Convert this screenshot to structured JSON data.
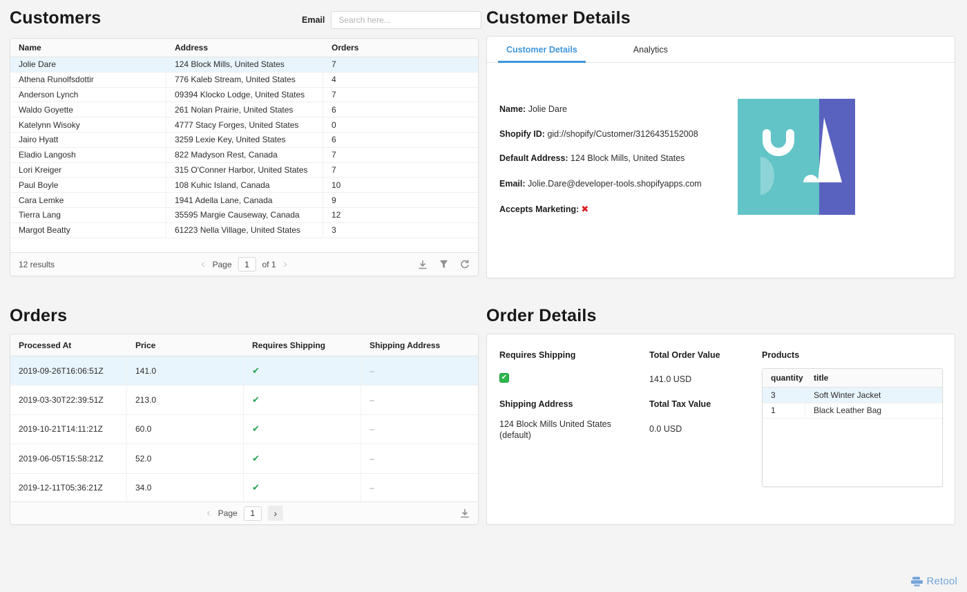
{
  "icons": {
    "chevron_left": "‹",
    "chevron_right": "›",
    "check_glyph": "✔",
    "cross_glyph": "✖",
    "footer_icons": [
      "download-icon",
      "filter-icon",
      "refresh-icon"
    ]
  },
  "colors": {
    "accent_blue": "#3f96db",
    "selected_row": "#e9f5fd",
    "check_green": "#21a453",
    "checkbox_green": "#2db84c",
    "cross_red": "#e01e1e",
    "avatar_teal": "#62c4c7",
    "avatar_indigo": "#5a62c0",
    "brand_blue": "#74a5da"
  },
  "customers": {
    "title": "Customers",
    "search": {
      "label": "Email",
      "placeholder": "Search here...",
      "value": ""
    },
    "table": {
      "columns": [
        "Name",
        "Address",
        "Orders"
      ],
      "selected_row": 0,
      "rows": [
        {
          "name": "Jolie Dare",
          "address": "124 Block Mills, United States",
          "orders": "7"
        },
        {
          "name": "Athena Runolfsdottir",
          "address": "776 Kaleb Stream, United States",
          "orders": "4"
        },
        {
          "name": "Anderson Lynch",
          "address": "09394 Klocko Lodge, United States",
          "orders": "7"
        },
        {
          "name": "Waldo Goyette",
          "address": "261 Nolan Prairie, United States",
          "orders": "6"
        },
        {
          "name": "Katelynn Wisoky",
          "address": "4777 Stacy Forges, United States",
          "orders": "0"
        },
        {
          "name": "Jairo Hyatt",
          "address": "3259 Lexie Key, United States",
          "orders": "6"
        },
        {
          "name": "Eladio Langosh",
          "address": "822 Madyson Rest, Canada",
          "orders": "7"
        },
        {
          "name": "Lori Kreiger",
          "address": "315 O'Conner Harbor, United States",
          "orders": "7"
        },
        {
          "name": "Paul Boyle",
          "address": "108 Kuhic Island, Canada",
          "orders": "10"
        },
        {
          "name": "Cara Lemke",
          "address": "1941 Adella Lane, Canada",
          "orders": "9"
        },
        {
          "name": "Tierra Lang",
          "address": "35595 Margie Causeway, Canada",
          "orders": "12"
        },
        {
          "name": "Margot Beatty",
          "address": "61223 Nella Village, United States",
          "orders": "3"
        }
      ],
      "footer": {
        "results": "12 results",
        "page_label": "Page",
        "page_value": "1",
        "of_label": "of 1"
      }
    }
  },
  "customer_details": {
    "title": "Customer Details",
    "tabs": [
      {
        "label": "Customer Details",
        "active": true
      },
      {
        "label": "Analytics",
        "active": false
      }
    ],
    "fields": [
      {
        "label": "Name:",
        "value": "Jolie Dare"
      },
      {
        "label": "Shopify ID:",
        "value": "gid://shopify/Customer/3126435152008"
      },
      {
        "label": "Default Address:",
        "value": "124 Block Mills, United States"
      },
      {
        "label": "Email:",
        "value": "Jolie.Dare@developer-tools.shopifyapps.com"
      },
      {
        "label": "Accepts Marketing:",
        "value": "cross-mark"
      }
    ]
  },
  "orders": {
    "title": "Orders",
    "table": {
      "columns": [
        "Processed At",
        "Price",
        "Requires Shipping",
        "Shipping Address"
      ],
      "selected_row": 0,
      "rows": [
        {
          "processed_at": "2019-09-26T16:06:51Z",
          "price": "141.0",
          "requires_shipping": "✔",
          "shipping_address": "–"
        },
        {
          "processed_at": "2019-03-30T22:39:51Z",
          "price": "213.0",
          "requires_shipping": "✔",
          "shipping_address": "–"
        },
        {
          "processed_at": "2019-10-21T14:11:21Z",
          "price": "60.0",
          "requires_shipping": "✔",
          "shipping_address": "–"
        },
        {
          "processed_at": "2019-06-05T15:58:21Z",
          "price": "52.0",
          "requires_shipping": "✔",
          "shipping_address": "–"
        },
        {
          "processed_at": "2019-12-11T05:36:21Z",
          "price": "34.0",
          "requires_shipping": "✔",
          "shipping_address": "–"
        }
      ],
      "footer": {
        "page_label": "Page",
        "page_value": "1"
      }
    }
  },
  "order_details": {
    "title": "Order Details",
    "requires_shipping_label": "Requires Shipping",
    "requires_shipping_value": "checked",
    "shipping_address_label": "Shipping Address",
    "shipping_address_value": "124 Block Mills United States (default)",
    "total_order_value_label": "Total Order Value",
    "total_order_value": "141.0 USD",
    "total_tax_value_label": "Total Tax Value",
    "total_tax_value": "0.0 USD",
    "products": {
      "label": "Products",
      "columns": [
        "quantity",
        "title"
      ],
      "selected_row": 0,
      "rows": [
        {
          "quantity": "3",
          "title": "Soft Winter Jacket"
        },
        {
          "quantity": "1",
          "title": "Black Leather Bag"
        }
      ]
    }
  },
  "brand": {
    "name": "Retool"
  }
}
